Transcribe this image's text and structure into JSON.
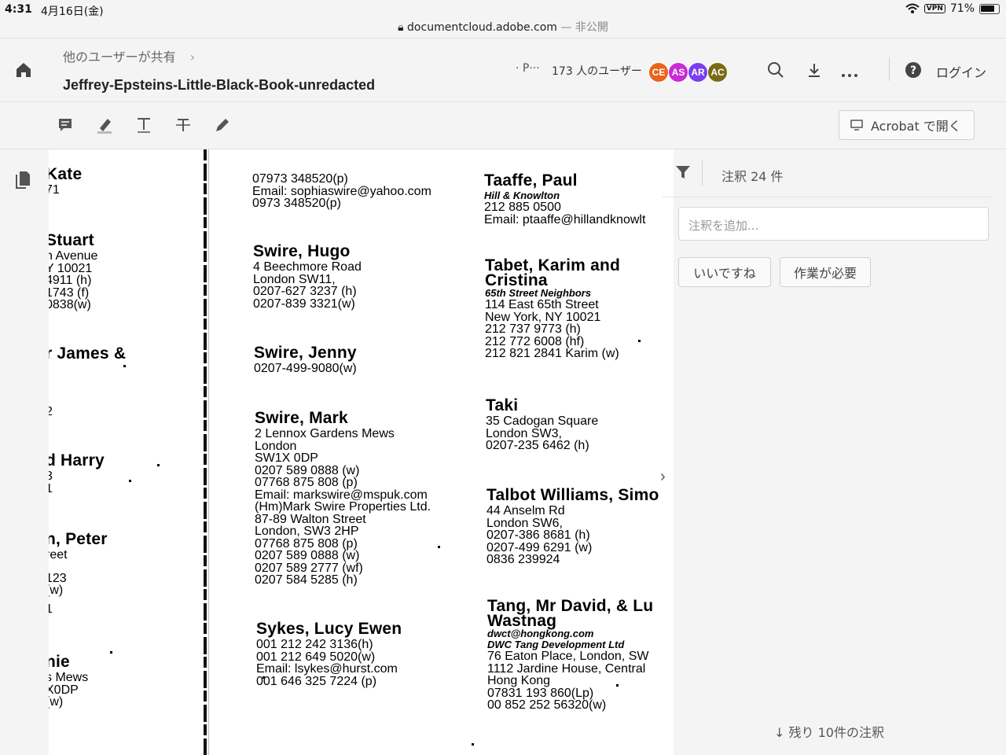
{
  "status_bar": {
    "time": "4:31",
    "date": "4月16日(金)",
    "url": "documentcloud.adobe.com",
    "url_suffix": "— 非公開",
    "vpn": "VPN",
    "battery": "71%"
  },
  "header": {
    "breadcrumb": "他のユーザーが共有",
    "document_title": "Jeffrey-Epsteins-Little-Black-Book-unredacted",
    "presence_label": "· P···",
    "users_count": "173 人のユーザー",
    "avatars": [
      {
        "initials": "CE",
        "color": "#e8641b"
      },
      {
        "initials": "AS",
        "color": "#c92bd6"
      },
      {
        "initials": "AR",
        "color": "#7a3ff0"
      },
      {
        "initials": "AC",
        "color": "#7b6a14"
      }
    ],
    "login_label": "ログイン"
  },
  "toolbar": {
    "tools": [
      "comment-icon",
      "highlight-icon",
      "text-icon",
      "strikethrough-icon",
      "draw-icon"
    ],
    "open_in_acrobat": "Acrobat で開く"
  },
  "comments_panel": {
    "count_label": "注釈 24 件",
    "add_placeholder": "注釈を追加...",
    "like_button": "いいですね",
    "action_needed_button": "作業が必要",
    "remaining_label": "残り 10件の注釈"
  },
  "document": {
    "col_left": [
      {
        "name": "Kate",
        "lines": [
          "71"
        ]
      },
      {
        "name": "Stuart",
        "lines": [
          "n Avenue",
          "Y 10021",
          "4911 (h)",
          "1743 (f)",
          "0838(w)"
        ]
      },
      {
        "name": "r James &",
        "lines": [
          "",
          "",
          "",
          "2"
        ]
      },
      {
        "name": "d Harry",
        "lines": [
          "3",
          "1"
        ]
      },
      {
        "name": "n, Peter",
        "lines": [
          "reet",
          "",
          "123",
          "(w)",
          "",
          "1"
        ]
      },
      {
        "name": "nie",
        "lines": [
          "s Mews",
          "X0DP",
          "(w)"
        ]
      }
    ],
    "col_mid": [
      {
        "name": "",
        "lines": [
          "07973 348520(p)",
          "Email: sophiaswire@yahoo.com",
          " 0973 348520(p)"
        ]
      },
      {
        "name": "Swire, Hugo",
        "lines": [
          "4 Beechmore Road",
          "London  SW11,",
          "0207-627 3237 (h)",
          "0207-839 3321(w)"
        ]
      },
      {
        "name": "Swire, Jenny",
        "lines": [
          "0207-499-9080(w)"
        ]
      },
      {
        "name": "Swire, Mark",
        "lines": [
          "2 Lennox Gardens Mews",
          "London",
          "SW1X 0DP",
          "0207 589 0888 (w)",
          "07768 875 808 (p)",
          "Email: markswire@mspuk.com",
          "(Hm)Mark Swire Properties Ltd.",
          "87-89 Walton Street",
          "London, SW3 2HP",
          "07768 875 808 (p)",
          "0207 589 0888 (w)",
          "0207 589 2777 (wf)",
          "0207 584 5285 (h)"
        ]
      },
      {
        "name": "Sykes, Lucy Ewen",
        "lines": [
          "001 212 242 3136(h)",
          "001 212 649 5020(w)",
          "Email: lsykes@hurst.com",
          "001 646 325 7224 (p)"
        ]
      }
    ],
    "col_right": [
      {
        "name": "Taaffe, Paul",
        "italic": "Hill & Knowlton",
        "lines": [
          "212 885 0500",
          "Email: ptaaffe@hillandknowlt"
        ]
      },
      {
        "name": "Tabet, Karim and",
        "name2": "Cristina",
        "italic": "65th Street Neighbors",
        "lines": [
          "114 East 65th Street",
          "New York, NY 10021",
          "212 737 9773 (h)",
          "212 772 6008 (hf)",
          "212 821 2841 Karim (w)"
        ]
      },
      {
        "name": "Taki",
        "lines": [
          "35 Cadogan Square",
          "London  SW3,",
          "0207-235 6462 (h)"
        ]
      },
      {
        "name": "Talbot Williams, Simo",
        "lines": [
          "44 Anselm Rd",
          "London   SW6,",
          "0207-386 8681 (h)",
          "0207-499 6291 (w)",
          "0836 239924"
        ]
      },
      {
        "name": "Tang, Mr David, & Lu",
        "name2": "Wastnag",
        "italic": "dwct@hongkong.com",
        "italic2": "DWC Tang Development Ltd",
        "lines": [
          "76 Eaton Place, London, SW",
          "1112 Jardine House, Central",
          "Hong Kong",
          "07831 193 860(Lp)",
          "00 852 252 56320(w)"
        ]
      }
    ]
  }
}
